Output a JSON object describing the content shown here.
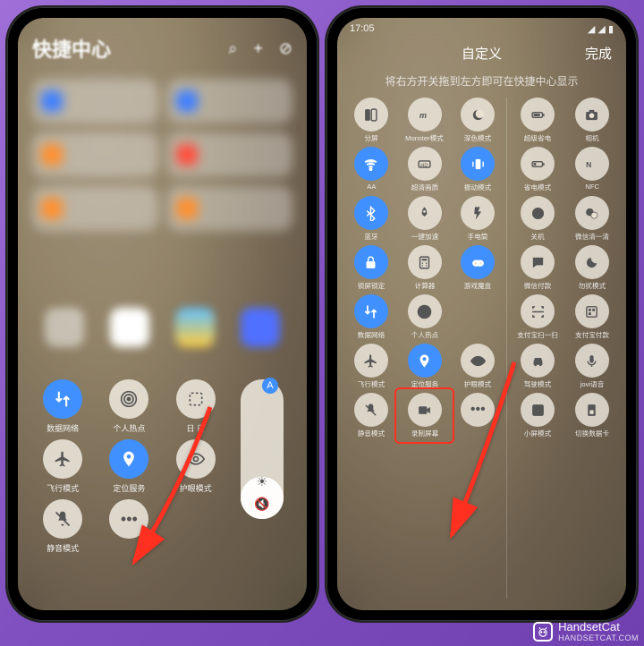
{
  "accent": "#4090ff",
  "highlight": "#ff3020",
  "watermark": {
    "brand": "HandsetCat",
    "url": "HANDSETCAT.COM"
  },
  "phone1": {
    "title": "快捷中心",
    "header_icons": [
      "search-icon",
      "plus-icon",
      "check-circle-icon"
    ],
    "tiles": [
      {
        "color": "blue"
      },
      {
        "color": "blue"
      },
      {
        "color": "orange"
      },
      {
        "color": "red"
      },
      {
        "color": "orange"
      },
      {
        "color": "orange"
      }
    ],
    "toggles_row1": [
      {
        "name": "data-network",
        "label": "数据网络",
        "active": true,
        "icon": "swap"
      },
      {
        "name": "hotspot",
        "label": "个人热点",
        "active": false,
        "icon": "hotspot"
      },
      {
        "name": "screenshot",
        "label": "日 日",
        "active": false,
        "icon": "capture"
      }
    ],
    "toggles_row2": [
      {
        "name": "airplane",
        "label": "飞行模式",
        "active": false,
        "icon": "plane"
      },
      {
        "name": "location",
        "label": "定位服务",
        "active": true,
        "icon": "pin"
      },
      {
        "name": "eyecare",
        "label": "护眼模式",
        "active": false,
        "icon": "eye"
      }
    ],
    "toggles_row3": [
      {
        "name": "silent",
        "label": "静音模式",
        "active": false,
        "icon": "mute"
      },
      {
        "name": "more",
        "label": "",
        "active": false,
        "icon": "more"
      }
    ],
    "slider_top_badge": "A"
  },
  "phone2": {
    "status_time": "17:05",
    "header_title": "自定义",
    "header_done": "完成",
    "hint": "将右方开关拖到左方即可在快捷中心显示",
    "left": [
      {
        "name": "split",
        "label": "分屏",
        "icon": "split",
        "active": false
      },
      {
        "name": "monster",
        "label": "Monster模式",
        "icon": "monster",
        "active": false
      },
      {
        "name": "dark",
        "label": "深色模式",
        "icon": "dark",
        "active": false
      },
      {
        "name": "wifi",
        "label": "AA",
        "icon": "wifi",
        "active": true
      },
      {
        "name": "superres",
        "label": "超清画质",
        "icon": "hd",
        "active": false
      },
      {
        "name": "vibrate",
        "label": "振动模式",
        "icon": "vibrate",
        "active": true
      },
      {
        "name": "bluetooth",
        "label": "蓝牙",
        "icon": "bt",
        "active": true
      },
      {
        "name": "boost",
        "label": "一键加速",
        "icon": "rocket",
        "active": false
      },
      {
        "name": "flashlight",
        "label": "手电筒",
        "icon": "flash",
        "active": false
      },
      {
        "name": "lock",
        "label": "锁屏锁定",
        "icon": "lock",
        "active": true
      },
      {
        "name": "calc",
        "label": "计算器",
        "icon": "calc",
        "active": false
      },
      {
        "name": "gamebox",
        "label": "游戏魔盒",
        "icon": "game",
        "active": true
      },
      {
        "name": "data",
        "label": "数据网络",
        "icon": "swap",
        "active": true
      },
      {
        "name": "hotspot",
        "label": "个人热点",
        "icon": "hotspot",
        "active": false
      },
      {
        "name": "blank1",
        "label": "",
        "icon": "",
        "active": false,
        "empty": true
      },
      {
        "name": "airplane",
        "label": "飞行模式",
        "icon": "plane",
        "active": false
      },
      {
        "name": "location",
        "label": "定位服务",
        "icon": "pin",
        "active": true
      },
      {
        "name": "eyecare",
        "label": "护眼模式",
        "icon": "eye",
        "active": false
      },
      {
        "name": "silent",
        "label": "静音模式",
        "icon": "mute",
        "active": false
      },
      {
        "name": "record",
        "label": "录制屏幕",
        "icon": "record",
        "active": false,
        "highlight": true
      },
      {
        "name": "more",
        "label": "",
        "icon": "more",
        "active": false
      }
    ],
    "right": [
      {
        "name": "powersave",
        "label": "超级省电",
        "icon": "battery"
      },
      {
        "name": "camera",
        "label": "相机",
        "icon": "camera"
      },
      {
        "name": "lowpower",
        "label": "省电模式",
        "icon": "battlow"
      },
      {
        "name": "nfc",
        "label": "NFC",
        "icon": "nfc"
      },
      {
        "name": "power",
        "label": "关机",
        "icon": "power"
      },
      {
        "name": "wxclean",
        "label": "微信清一清",
        "icon": "wx"
      },
      {
        "name": "wxpay",
        "label": "微信付款",
        "icon": "chat"
      },
      {
        "name": "dnd",
        "label": "勿扰模式",
        "icon": "moon"
      },
      {
        "name": "alipay",
        "label": "支付宝扫一扫",
        "icon": "scan"
      },
      {
        "name": "alipay2",
        "label": "支付宝付款",
        "icon": "pay"
      },
      {
        "name": "drive",
        "label": "驾驶模式",
        "icon": "car"
      },
      {
        "name": "jovi",
        "label": "jovi语音",
        "icon": "voice"
      },
      {
        "name": "mini",
        "label": "小屏模式",
        "icon": "mini"
      },
      {
        "name": "sim",
        "label": "切换数据卡",
        "icon": "sim"
      }
    ]
  }
}
